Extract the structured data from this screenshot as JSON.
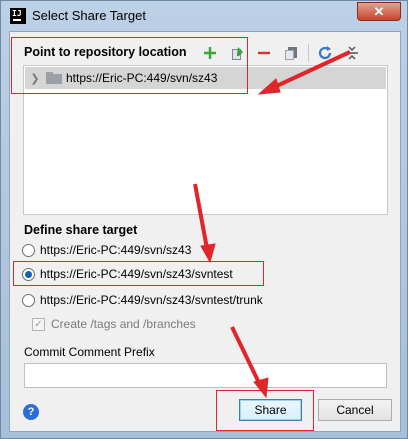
{
  "window": {
    "title": "Select Share Target",
    "close_label": "✕",
    "app_icon_label": "IJ"
  },
  "repository": {
    "section_title": "Point to repository location",
    "toolbar": [
      {
        "name": "add-icon",
        "glyph": "+"
      },
      {
        "name": "edit-icon",
        "glyph": "✎"
      },
      {
        "name": "remove-icon",
        "glyph": "−"
      },
      {
        "name": "copy-icon",
        "glyph": "▤"
      },
      {
        "name": "refresh-icon",
        "glyph": "↻"
      },
      {
        "name": "collapse-icon",
        "glyph": "⇕"
      }
    ],
    "items": [
      {
        "label": "https://Eric-PC:449/svn/sz43",
        "selected": true
      }
    ]
  },
  "share_target": {
    "section_title": "Define share target",
    "options": [
      {
        "label": "https://Eric-PC:449/svn/sz43",
        "checked": false
      },
      {
        "label": "https://Eric-PC:449/svn/sz43/svntest",
        "checked": true
      },
      {
        "label": "https://Eric-PC:449/svn/sz43/svntest/trunk",
        "checked": false
      }
    ],
    "create_tags_label": "Create /tags and /branches",
    "create_tags_checked": true,
    "create_tags_enabled": false
  },
  "comment": {
    "label": "Commit Comment Prefix",
    "value": "",
    "placeholder": ""
  },
  "buttons": {
    "help": "?",
    "share": "Share",
    "cancel": "Cancel"
  },
  "colors": {
    "accent": "#1a5fb4",
    "annotation_red": "#e0252b",
    "add_green": "#3aa43a",
    "remove_red": "#d8302f",
    "refresh_blue": "#3a77c8"
  }
}
